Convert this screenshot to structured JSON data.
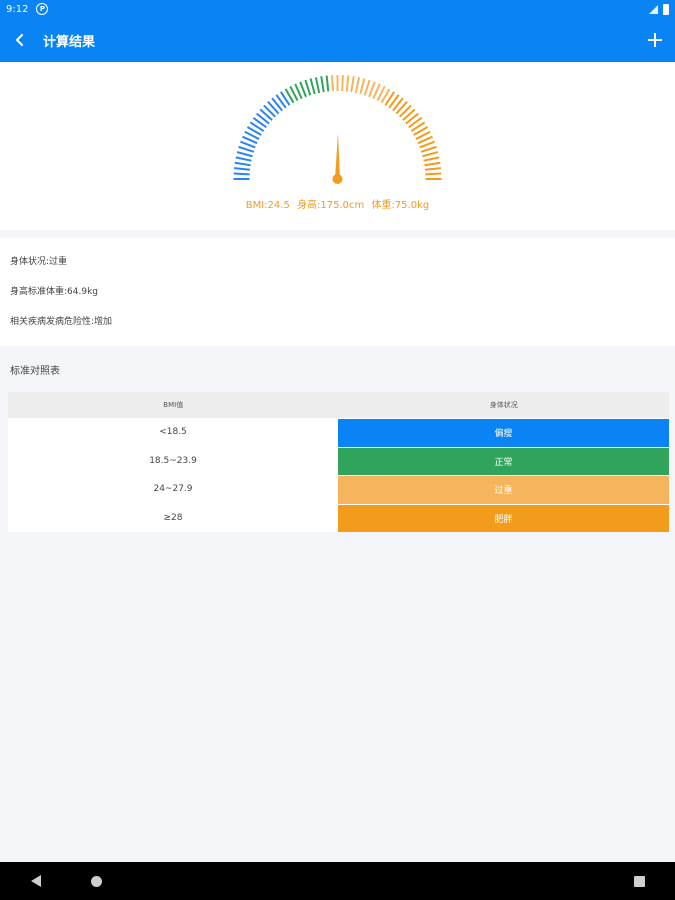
{
  "status_bar": {
    "time": "9:12",
    "notification_icon": "p-circle-icon"
  },
  "app_bar": {
    "title": "计算结果",
    "back_icon": "chevron-left-icon",
    "add_icon": "plus-icon"
  },
  "gauge": {
    "bmi_text": "BMI:24.5",
    "height_text": "身高:175.0cm",
    "weight_text": "体重:75.0kg",
    "value": 24.5,
    "colors": {
      "underweight": "#2a85ef",
      "normal": "#2fa45a",
      "overweight": "#f6b55c",
      "obese": "#f39b1b",
      "needle": "#f39b1b"
    }
  },
  "info": {
    "body_status": "身体状况:过重",
    "standard_weight": "身高标准体重:64.9kg",
    "disease_risk": "相关疾病发病危险性:增加"
  },
  "table": {
    "section_title": "标准对照表",
    "headers": [
      "BMI值",
      "身体状况"
    ],
    "rows": [
      {
        "range": "<18.5",
        "status": "偏瘦",
        "color": "#0a84f5"
      },
      {
        "range": "18.5~23.9",
        "status": "正常",
        "color": "#2fa45a"
      },
      {
        "range": "24~27.9",
        "status": "过重",
        "color": "#f6b55c"
      },
      {
        "range": "≥28",
        "status": "肥胖",
        "color": "#f39b1b"
      }
    ]
  },
  "nav_bar": {
    "back_icon": "triangle-back-icon",
    "home_icon": "circle-home-icon",
    "recents_icon": "square-recents-icon"
  }
}
